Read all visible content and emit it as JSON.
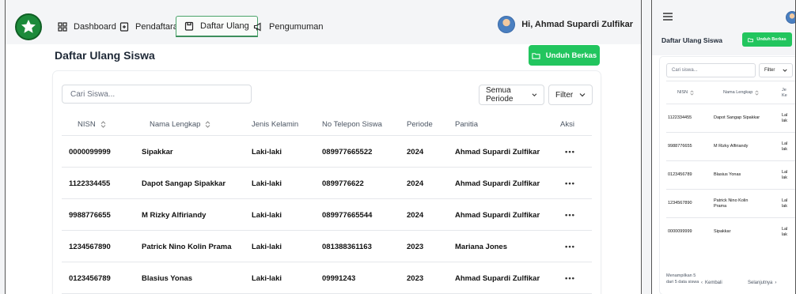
{
  "nav": {
    "tabs": [
      {
        "label": "Dashboard",
        "icon": "grid-icon"
      },
      {
        "label": "Pendaftaran",
        "icon": "form-icon"
      },
      {
        "label": "Daftar Ulang",
        "icon": "clipboard-icon",
        "active": true
      },
      {
        "label": "Pengumuman",
        "icon": "megaphone-icon"
      }
    ],
    "greeting": "Hi, Ahmad Supardi Zulfikar"
  },
  "page": {
    "title": "Daftar Ulang Siswa",
    "download_label": "Unduh Berkas",
    "search_placeholder": "Cari Siswa...",
    "period_label": "Semua Periode",
    "filter_label": "Filter"
  },
  "table": {
    "headers": {
      "nisn": "NISN",
      "nama": "Nama Lengkap",
      "jk": "Jenis Kelamin",
      "telp": "No Telepon Siswa",
      "periode": "Periode",
      "panitia": "Panitia",
      "aksi": "Aksi"
    },
    "rows": [
      {
        "nisn": "0000099999",
        "nama": "Sipakkar",
        "jk": "Laki-laki",
        "telp": "089977665522",
        "periode": "2024",
        "panitia": "Ahmad Supardi Zulfikar",
        "aksi": "•••"
      },
      {
        "nisn": "1122334455",
        "nama": "Dapot Sangap Sipakkar",
        "jk": "Laki-laki",
        "telp": "0899776622",
        "periode": "2024",
        "panitia": "Ahmad Supardi Zulfikar",
        "aksi": "•••"
      },
      {
        "nisn": "9988776655",
        "nama": "M Rizky Alfiriandy",
        "jk": "Laki-laki",
        "telp": "089977665544",
        "periode": "2024",
        "panitia": "Ahmad Supardi Zulfikar",
        "aksi": "•••"
      },
      {
        "nisn": "1234567890",
        "nama": "Patrick Nino Kolin Prama",
        "jk": "Laki-laki",
        "telp": "081388361163",
        "periode": "2023",
        "panitia": "Mariana Jones",
        "aksi": "•••"
      },
      {
        "nisn": "0123456789",
        "nama": "Blasius Yonas",
        "jk": "Laki-laki",
        "telp": "09991243",
        "periode": "2023",
        "panitia": "Ahmad Supardi Zulfikar",
        "aksi": "•••"
      }
    ]
  },
  "mobile": {
    "title": "Daftar Ulang Siswa",
    "download_label": "Unduh Berkas",
    "search_placeholder": "Cari siswa...",
    "filter_label": "Filter",
    "headers": {
      "nisn": "NISN",
      "nama": "Nama Lengkap",
      "jk1": "Je",
      "jk2": "Ke"
    },
    "rows": [
      {
        "nisn": "1122334455",
        "nama": "Dapot Sangap Sipakkar",
        "jk1": "Lal",
        "jk2": "lak"
      },
      {
        "nisn": "9988776655",
        "nama": "M Rizky Alfiriandy",
        "jk1": "Lal",
        "jk2": "lak"
      },
      {
        "nisn": "0123456789",
        "nama": "Blasius Yonas",
        "jk1": "Lal",
        "jk2": "lak"
      },
      {
        "nisn": "1234567890",
        "nama": "Patrick Nino Kolin Prama",
        "jk1": "Lal",
        "jk2": "lak"
      },
      {
        "nisn": "0000099999",
        "nama": "Sipakkar",
        "jk1": "Lal",
        "jk2": "lak"
      }
    ],
    "footer_info": "Menampilkan 5 dari 5 data siswa",
    "prev_label": "Kembali",
    "next_label": "Selanjutnya"
  },
  "colors": {
    "accent": "#22c55e",
    "brand": "#1c8a3a",
    "active_tab_border": "#4aa36a"
  }
}
